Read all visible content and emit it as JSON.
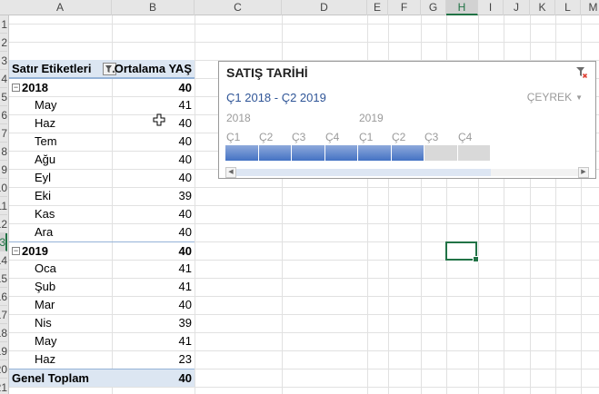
{
  "columns": [
    "A",
    "B",
    "C",
    "D",
    "E",
    "F",
    "G",
    "H",
    "I",
    "J",
    "K",
    "L",
    "M"
  ],
  "selected_column": "H",
  "rows": [
    "1",
    "2",
    "3",
    "4",
    "5",
    "6",
    "7",
    "8",
    "9",
    "10",
    "11",
    "12",
    "13",
    "14",
    "15",
    "16",
    "17",
    "18",
    "19",
    "20",
    "21"
  ],
  "selected_row": "13",
  "pivot": {
    "header": {
      "row_labels": "Satır Etiketleri",
      "value_field": "Ortalama YAŞ"
    },
    "groups": [
      {
        "year": "2018",
        "value": "40",
        "collapse_symbol": "−",
        "months": [
          {
            "label": "May",
            "value": "41"
          },
          {
            "label": "Haz",
            "value": "40"
          },
          {
            "label": "Tem",
            "value": "40"
          },
          {
            "label": "Ağu",
            "value": "40"
          },
          {
            "label": "Eyl",
            "value": "40"
          },
          {
            "label": "Eki",
            "value": "39"
          },
          {
            "label": "Kas",
            "value": "40"
          },
          {
            "label": "Ara",
            "value": "40"
          }
        ]
      },
      {
        "year": "2019",
        "value": "40",
        "collapse_symbol": "−",
        "months": [
          {
            "label": "Oca",
            "value": "41"
          },
          {
            "label": "Şub",
            "value": "41"
          },
          {
            "label": "Mar",
            "value": "40"
          },
          {
            "label": "Nis",
            "value": "39"
          },
          {
            "label": "May",
            "value": "41"
          },
          {
            "label": "Haz",
            "value": "23"
          }
        ]
      }
    ],
    "grand_total": {
      "label": "Genel Toplam",
      "value": "40"
    }
  },
  "timeline": {
    "title": "SATIŞ TARİHİ",
    "range": "Ç1 2018 - Ç2 2019",
    "level": "ÇEYREK",
    "years": [
      "2018",
      "2019"
    ],
    "quarters": [
      "Ç1",
      "Ç2",
      "Ç3",
      "Ç4",
      "Ç1",
      "Ç2",
      "Ç3",
      "Ç4"
    ],
    "quarter_selected": [
      true,
      true,
      true,
      true,
      true,
      true,
      false,
      false
    ],
    "accent_color": "#4472c4"
  }
}
